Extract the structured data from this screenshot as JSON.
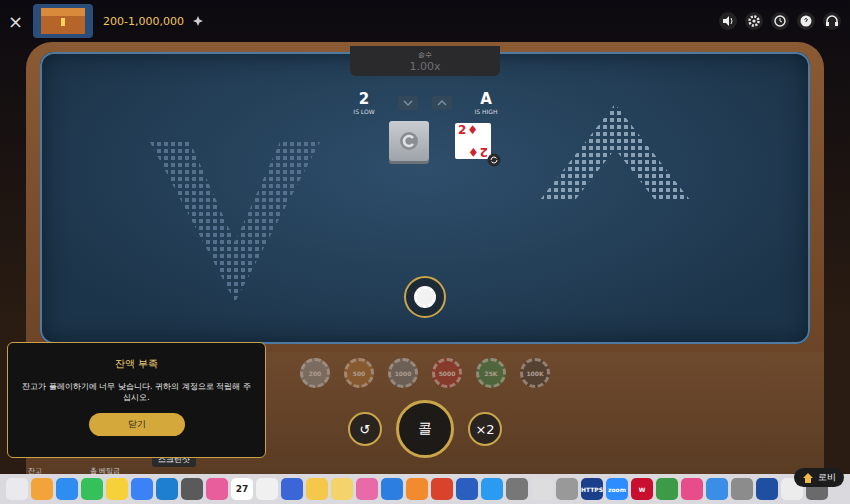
{
  "header": {
    "close": "×",
    "bet_limits": "200-1,000,000"
  },
  "multiplier": {
    "label": "승수",
    "value": "1.00x"
  },
  "hints": [
    {
      "rank": "2",
      "text": "IS LOW"
    },
    {
      "rank": "A",
      "text": "IS HIGH"
    }
  ],
  "card": {
    "rank": "2",
    "suit": "♦"
  },
  "chips": [
    {
      "value": "200",
      "color": "#8f979f",
      "disabled": true
    },
    {
      "value": "500",
      "color": "#a86f36",
      "disabled": true
    },
    {
      "value": "1000",
      "color": "#6f7c88",
      "disabled": true
    },
    {
      "value": "5000",
      "color": "#a82c2c",
      "disabled": true
    },
    {
      "value": "25K",
      "color": "#2f8a52",
      "disabled": true
    },
    {
      "value": "100K",
      "color": "#3a3a3a",
      "disabled": true
    }
  ],
  "controls": {
    "undo": "↺",
    "call": "콜",
    "double": "×2"
  },
  "dialog": {
    "title": "잔액 부족",
    "message": "잔고가 플레이하기에 너무 낮습니다. 귀하의 계정으로 적립해 주십시오.",
    "button": "닫기"
  },
  "balance_labels": [
    "잔고",
    "총 베팅금"
  ],
  "tooltip": "스크린샷",
  "lobby": "로비",
  "dock": [
    {
      "color": "#e9e9ee"
    },
    {
      "color": "#f2a33a"
    },
    {
      "color": "#2f8cf0"
    },
    {
      "color": "#36c05a"
    },
    {
      "color": "#f7d13a"
    },
    {
      "color": "#3b82f6"
    },
    {
      "color": "#1e7fd0"
    },
    {
      "color": "#5a5a5a"
    },
    {
      "color": "#e85d9b"
    },
    {
      "color": "#ffffff",
      "label": "27"
    },
    {
      "color": "#f0f0f0"
    },
    {
      "color": "#3a66d8"
    },
    {
      "color": "#f5c84b"
    },
    {
      "color": "#f3d36a"
    },
    {
      "color": "#e86aa8"
    },
    {
      "color": "#2c7fe0"
    },
    {
      "color": "#f28a2e"
    },
    {
      "color": "#d9432b"
    },
    {
      "color": "#2b5fbf"
    },
    {
      "color": "#2a9bf0"
    },
    {
      "color": "#777777"
    },
    {
      "color": "#dddddd"
    },
    {
      "color": "#999999"
    },
    {
      "color": "#1c3f8c",
      "label": "HTTPS"
    },
    {
      "color": "#2d8cff",
      "label": "zoom"
    },
    {
      "color": "#c8102e",
      "label": "W"
    },
    {
      "color": "#3d9b47"
    },
    {
      "color": "#e74c8b"
    },
    {
      "color": "#3a8ee6"
    },
    {
      "color": "#8c8c8c"
    },
    {
      "color": "#1f4fa0"
    },
    {
      "color": "#ececec"
    },
    {
      "color": "#6a6a6a"
    }
  ]
}
